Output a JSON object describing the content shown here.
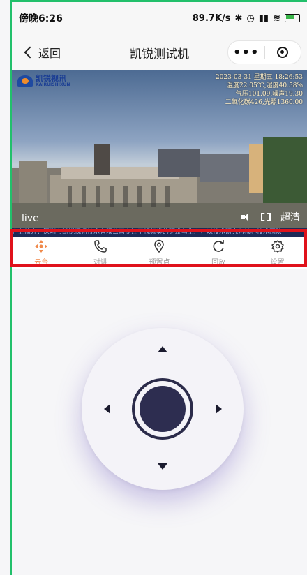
{
  "status_bar": {
    "time": "傍晚6:26",
    "speed": "89.7K/s"
  },
  "nav": {
    "back_label": "返回",
    "title": "凯锐测试机",
    "more_label": "•••"
  },
  "video": {
    "logo_cn": "凯锐视讯",
    "logo_en": "KAIRUISHIXUN",
    "osd_lines": [
      "2023-03-31 星期五 18:26:53",
      "温度22.05℃,湿度40.58%",
      "气压101.09,噪声19.30",
      "二氧化碳426,光照1360.00"
    ],
    "live_label": "live",
    "quality_label": "超清"
  },
  "ticker": "企业简介：深圳市凯锐视讯技术有限公司专注于视频类的研发与生产，以技术研究为核心技术团队",
  "tabs": [
    {
      "label": "云台",
      "icon": "ptz-icon",
      "active": true
    },
    {
      "label": "对讲",
      "icon": "phone-icon",
      "active": false
    },
    {
      "label": "预置点",
      "icon": "location-pin-icon",
      "active": false
    },
    {
      "label": "回放",
      "icon": "replay-icon",
      "active": false
    },
    {
      "label": "设置",
      "icon": "gear-icon",
      "active": false
    }
  ],
  "colors": {
    "accent": "#f0894a",
    "highlight_box": "#e0121b",
    "pad_dark": "#2d2d50"
  }
}
